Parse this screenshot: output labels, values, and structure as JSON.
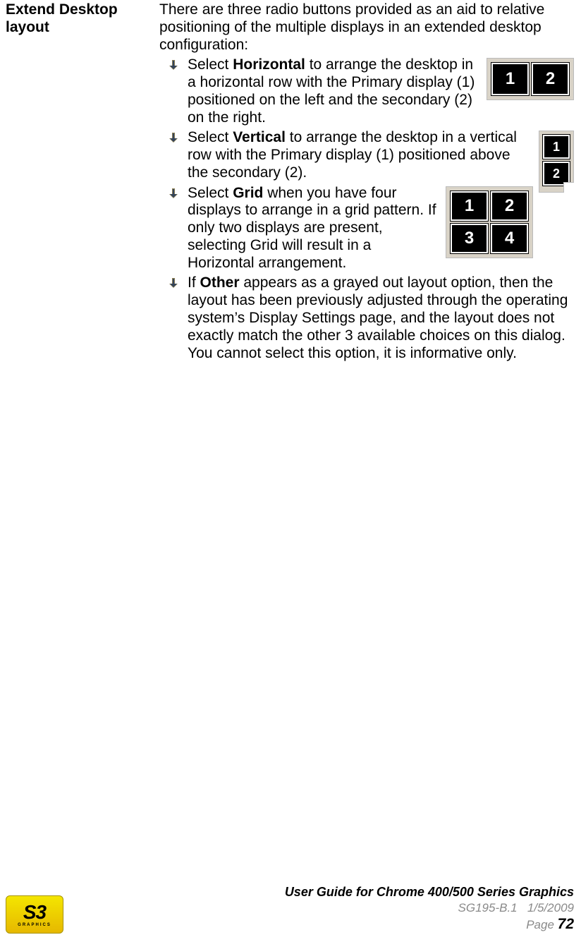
{
  "section": {
    "label_line1": "Extend Desktop",
    "label_line2": "layout",
    "intro": "There are three radio buttons provided as an aid to relative positioning of the multiple displays in an extended desktop configuration:",
    "items": [
      {
        "bold": "Horizontal",
        "pre": "Select ",
        "post": " to arrange the desktop in a horizontal row with the Primary display (1) positioned on the left and the secondary (2) on the right."
      },
      {
        "bold": "Vertical",
        "pre": "Select ",
        "post": " to arrange the desktop in a vertical row with the Primary display (1) positioned above the secondary (2)."
      },
      {
        "bold": "Grid",
        "pre": "Select ",
        "post": " when you have four displays to arrange in a grid pattern. If only two displays are present, selecting Grid will result in a Horizontal arrangement."
      },
      {
        "bold": "Other",
        "pre": "If ",
        "post": " appears as a grayed out layout option, then the layout has been previously adjusted through the operating system’s Display Settings page, and the layout does not exactly match the other 3 available choices on this dialog. You cannot select this option, it is informative only."
      }
    ],
    "illus": {
      "horizontal": [
        "1",
        "2"
      ],
      "vertical": [
        "1",
        "2"
      ],
      "grid": [
        "1",
        "2",
        "3",
        "4"
      ]
    }
  },
  "footer": {
    "logo_text": "S3",
    "logo_sub": "GRAPHICS",
    "title": "User Guide for Chrome 400/500 Series Graphics",
    "doc_id": "SG195-B.1",
    "date": "1/5/2009",
    "page_label": "Page ",
    "page_num": "72"
  }
}
